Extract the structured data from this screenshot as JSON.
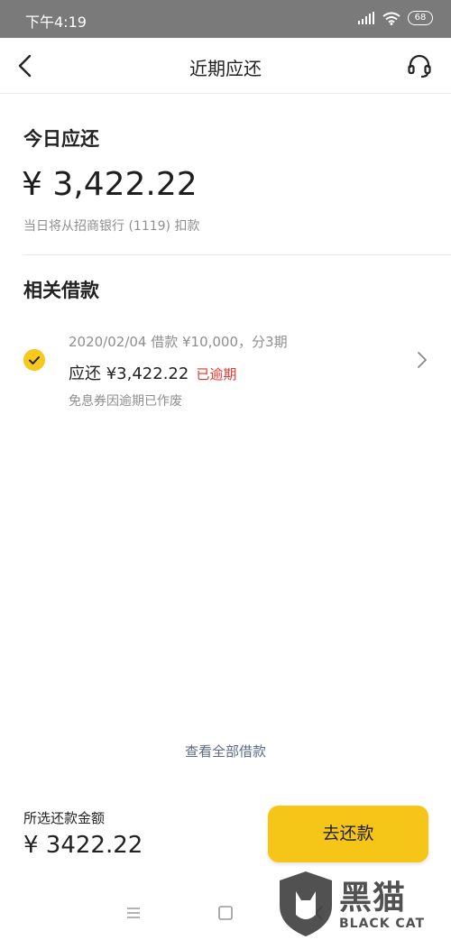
{
  "status_bar": {
    "time": "下午4:19",
    "battery": "68",
    "signal_icon": "signal-icon",
    "wifi_icon": "wifi-icon"
  },
  "nav": {
    "title": "近期应还",
    "back_icon": "chevron-left-icon",
    "service_icon": "headset-icon"
  },
  "today": {
    "title": "今日应还",
    "amount": "¥ 3,422.22",
    "note": "当日将从招商银行 (1119) 扣款"
  },
  "related": {
    "title": "相关借款",
    "loan": {
      "line1": "2020/02/04 借款 ¥10,000，分3期",
      "due": "应还 ¥3,422.22",
      "status": "已逾期",
      "note": "免息券因逾期已作废",
      "selected": true
    }
  },
  "view_all": "查看全部借款",
  "footer": {
    "label": "所选还款金额",
    "amount": "¥ 3422.22",
    "pay_button": "去还款"
  },
  "watermark": {
    "cn": "黑猫",
    "en": "BLACK CAT"
  },
  "colors": {
    "accent": "#f5c518",
    "overdue": "#e0382b",
    "link": "#5b6a8a"
  }
}
